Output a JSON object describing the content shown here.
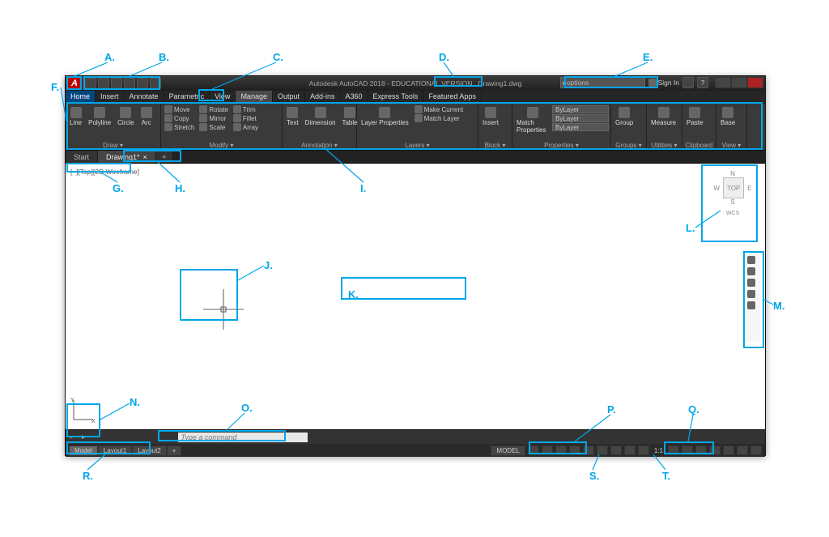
{
  "app": {
    "logo_letter": "A",
    "title": "Autodesk AutoCAD 2018 - EDUCATIONAL VERSION",
    "filename": "Drawing1.dwg",
    "search_placeholder": "options",
    "signin_label": "Sign In"
  },
  "qat_icons": [
    "new",
    "open",
    "save",
    "print",
    "undo",
    "redo"
  ],
  "menu_tabs": [
    "Home",
    "Insert",
    "Annotate",
    "Parametric",
    "View",
    "Manage",
    "Output",
    "Add-ins",
    "A360",
    "Express Tools",
    "Featured Apps"
  ],
  "menu_active": "Home",
  "menu_highlight": "Manage",
  "ribbon": {
    "draw": {
      "title": "Draw ▾",
      "items": [
        "Line",
        "Polyline",
        "Circle",
        "Arc"
      ]
    },
    "modify": {
      "title": "Modify ▾",
      "col1": [
        "Move",
        "Copy",
        "Stretch"
      ],
      "col2": [
        "Rotate",
        "Mirror",
        "Scale"
      ],
      "col3": [
        "Trim",
        "Fillet",
        "Array"
      ]
    },
    "annotation": {
      "title": "Annotation ▾",
      "items": [
        "Text",
        "Dimension",
        "Table"
      ]
    },
    "layers": {
      "title": "Layers ▾",
      "main": "Layer Properties",
      "items": [
        "Make Current",
        "Match Layer"
      ]
    },
    "block": {
      "title": "Block ▾",
      "items": [
        "Insert"
      ]
    },
    "properties": {
      "title": "Properties ▾",
      "main": "Match Properties",
      "bylayer": "ByLayer"
    },
    "groups": {
      "title": "Groups ▾",
      "items": [
        "Group"
      ]
    },
    "utilities": {
      "title": "Utilities ▾",
      "items": [
        "Measure"
      ]
    },
    "clipboard": {
      "title": "Clipboard",
      "items": [
        "Paste"
      ]
    },
    "view": {
      "title": "View ▾",
      "items": [
        "Base"
      ]
    }
  },
  "file_tabs": {
    "start": "Start",
    "active": "Drawing1*"
  },
  "viewport_label": "[–][Top][2D Wireframe]",
  "viewcube": {
    "n": "N",
    "s": "S",
    "e": "E",
    "w": "W",
    "top": "TOP",
    "wcs": "WCS"
  },
  "command": {
    "placeholder": "Type a command"
  },
  "layout_tabs": [
    "Model",
    "Layout1",
    "Layout2"
  ],
  "status": {
    "model_label": "MODEL",
    "scale": "1:1"
  },
  "callouts": {
    "A": "A.",
    "B": "B.",
    "C": "C.",
    "D": "D.",
    "E": "E.",
    "F": "F.",
    "G": "G.",
    "H": "H.",
    "I": "I.",
    "J": "J.",
    "K": "K.",
    "L": "L.",
    "M": "M.",
    "N": "N.",
    "O": "O.",
    "P": "P.",
    "Q": "Q.",
    "R": "R.",
    "S": "S.",
    "T": "T."
  }
}
